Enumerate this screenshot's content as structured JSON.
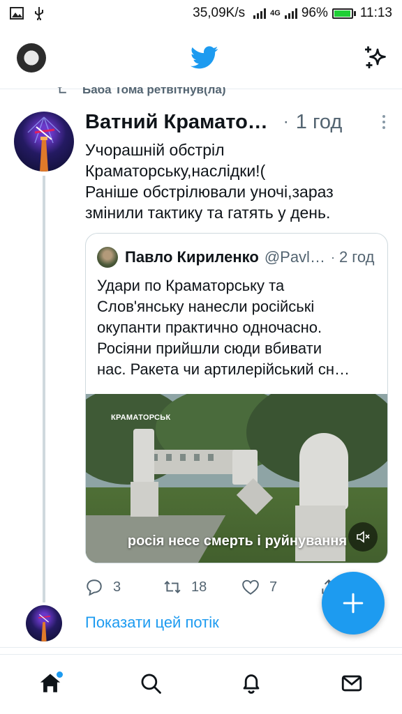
{
  "status_bar": {
    "speed": "35,09K/s",
    "network": "4G",
    "battery": "96%",
    "battery_level": 0.96,
    "time": "11:13"
  },
  "app": {
    "colors": {
      "accent": "#1d9bf0",
      "text": "#0f1419",
      "muted": "#536471",
      "divider": "#e6ecf0"
    }
  },
  "tweet": {
    "retweet_context": "Баба Тома ретвітнув(ла)",
    "author_name": "Ватний Крамато…",
    "time": "1 год",
    "text_lines": [
      "Учорашній обстріл",
      "Краматорську,наслідки!(",
      "Раніше обстрілювали уночі,зараз",
      "змінили тактику та гатять у день."
    ],
    "quote": {
      "author_name": "Павло Кириленко",
      "handle": "@Pavl…",
      "time": "2 год",
      "text_lines": [
        "Удари по Краматорську та",
        "Слов'янську нанесли російські",
        "окупанти практично одночасно.",
        "Росіяни прийшли сюди вбивати",
        "нас. Ракета чи артилерійський сн…"
      ],
      "media": {
        "watermark": "КРАМАТОРСЬК",
        "caption": "росія несе смерть і руйнування"
      }
    },
    "actions": {
      "replies": "3",
      "retweets": "18",
      "likes": "7"
    }
  },
  "show_thread": "Показати цей потік",
  "icons": {
    "bird": "twitter-bird-icon",
    "sparkle": "sparkle-icon",
    "reply": "reply-icon",
    "retweet": "retweet-icon",
    "like": "heart-icon",
    "share": "share-icon",
    "compose": "plus-icon",
    "home": "home-icon",
    "search": "search-icon",
    "notifications": "bell-icon",
    "messages": "mail-icon"
  }
}
